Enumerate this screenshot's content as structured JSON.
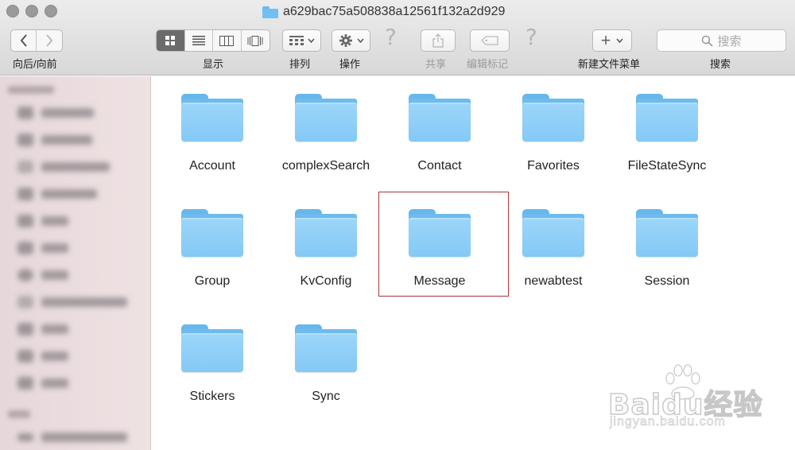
{
  "window": {
    "title": "a629bac75a508838a12561f132a2d929"
  },
  "toolbar": {
    "nav_label": "向后/向前",
    "view_label": "显示",
    "arrange_label": "排列",
    "action_label": "操作",
    "share_label": "共享",
    "edit_tags_label": "编辑标记",
    "new_menu_label": "新建文件菜单",
    "search_label": "搜索",
    "search_placeholder": "搜索",
    "back_glyph": "‹",
    "forward_glyph": "›",
    "plus_glyph": "+",
    "question_glyph": "?",
    "active_view": "icon"
  },
  "folders": [
    {
      "name": "Account"
    },
    {
      "name": "complexSearch"
    },
    {
      "name": "Contact"
    },
    {
      "name": "Favorites"
    },
    {
      "name": "FileStateSync"
    },
    {
      "name": "Group"
    },
    {
      "name": "KvConfig"
    },
    {
      "name": "Message",
      "highlighted": true
    },
    {
      "name": "newabtest"
    },
    {
      "name": "Session"
    },
    {
      "name": "Stickers"
    },
    {
      "name": "Sync"
    }
  ],
  "colors": {
    "folder_front": "#84c9f6",
    "folder_back": "#6dbbef",
    "highlight": "#b03535",
    "sidebar_bg": "#ecdfe0"
  },
  "watermark": {
    "logo": "Baidu经验",
    "url": "jingyan.baidu.com"
  }
}
